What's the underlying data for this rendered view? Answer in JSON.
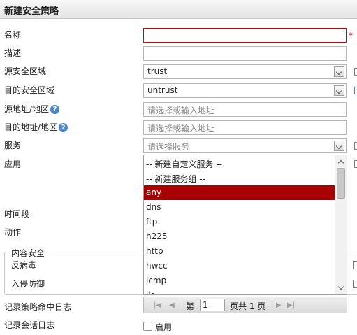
{
  "dialog": {
    "title": "新建安全策略"
  },
  "form": {
    "name_label": "名称",
    "name_value": "",
    "required_mark": "*",
    "desc_label": "描述",
    "desc_value": "",
    "src_zone_label": "源安全区域",
    "src_zone_value": "trust",
    "dst_zone_label": "目的安全区域",
    "dst_zone_value": "untrust",
    "src_addr_label": "源地址/地区",
    "src_addr_placeholder": "请选择或输入地址",
    "dst_addr_label": "目的地址/地区",
    "dst_addr_placeholder": "请选择或输入地址",
    "service_label": "服务",
    "service_placeholder": "请选择服务",
    "app_label": "应用",
    "time_label": "时间段",
    "action_label": "动作",
    "content_security_legend": "内容安全",
    "antivirus_label": "反病毒",
    "ips_label": "入侵防御",
    "log_hit_label": "记录策略命中日志",
    "log_session_label": "记录会话日志",
    "enable_label": "启用",
    "help_icon_glyph": "?"
  },
  "service_dropdown": {
    "options": [
      "-- 新建自定义服务 --",
      "-- 新建服务组 --",
      "any",
      "dns",
      "ftp",
      "h225",
      "http",
      "hwcc",
      "icmp",
      "ils"
    ],
    "selected": "any",
    "pager": {
      "page_label": "第",
      "page_value": "1",
      "total_label": "页共 1 页"
    }
  },
  "colors": {
    "accent": "#a80000",
    "help": "#4d86c8",
    "required": "#cc0000"
  }
}
